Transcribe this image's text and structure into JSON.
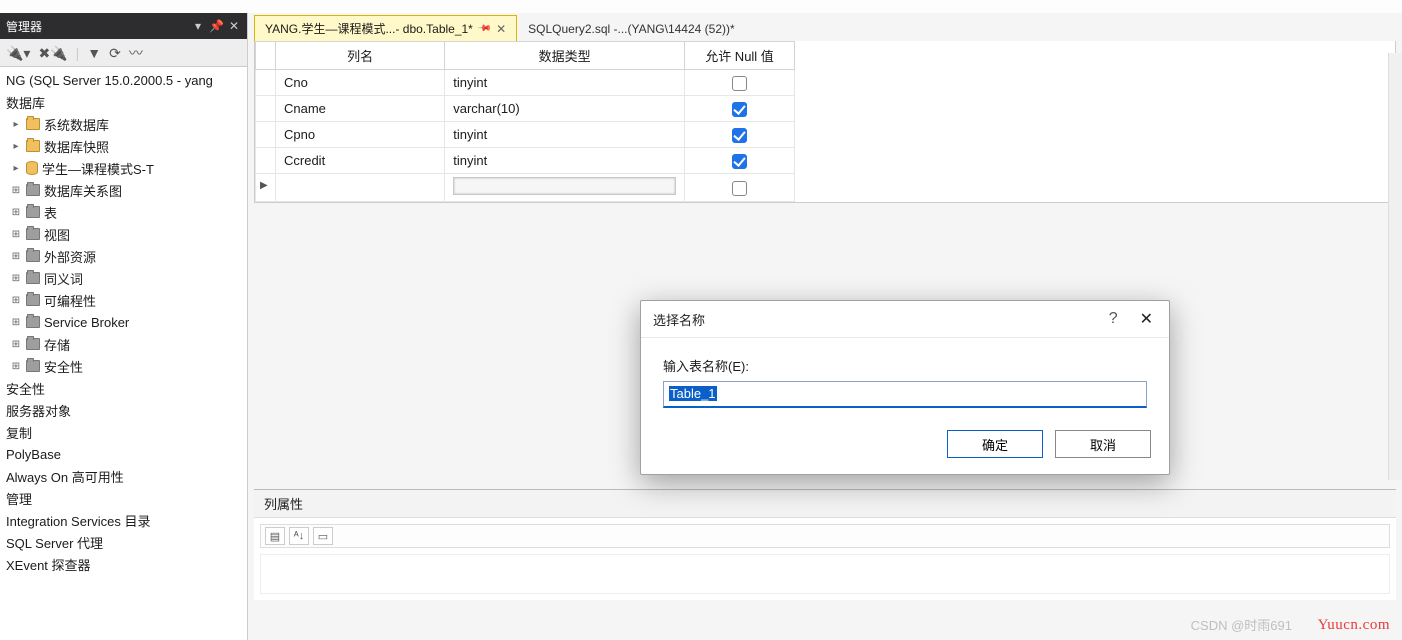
{
  "sidebar": {
    "title": "管理器",
    "server_node": "NG (SQL Server 15.0.2000.5 - yang",
    "db_root": "数据库",
    "items": [
      "系统数据库",
      "数据库快照",
      "学生—课程模式S-T"
    ],
    "subitems": [
      "数据库关系图",
      "表",
      "视图",
      "外部资源",
      "同义词",
      "可编程性",
      "Service Broker",
      "存储",
      "安全性"
    ],
    "tail": [
      "安全性",
      "服务器对象",
      "复制",
      "PolyBase",
      "Always On 高可用性",
      "管理",
      "Integration Services 目录",
      "SQL Server 代理",
      "XEvent 探查器"
    ]
  },
  "tabs": {
    "active": "YANG.学生—课程模式...- dbo.Table_1*",
    "inactive": "SQLQuery2.sql -...(YANG\\14424 (52))*"
  },
  "designer": {
    "headers": {
      "name": "列名",
      "dtype": "数据类型",
      "nullable": "允许 Null 值"
    },
    "rows": [
      {
        "name": "Cno",
        "dtype": "tinyint",
        "null": false
      },
      {
        "name": "Cname",
        "dtype": "varchar(10)",
        "null": true
      },
      {
        "name": "Cpno",
        "dtype": "tinyint",
        "null": true
      },
      {
        "name": "Ccredit",
        "dtype": "tinyint",
        "null": true
      }
    ]
  },
  "propPanel": {
    "title": "列属性"
  },
  "dialog": {
    "title": "选择名称",
    "label": "输入表名称(E):",
    "value": "Table_1",
    "ok": "确定",
    "cancel": "取消"
  },
  "watermarks": {
    "site": "Yuucn.com",
    "csdn": "CSDN @时雨691"
  }
}
